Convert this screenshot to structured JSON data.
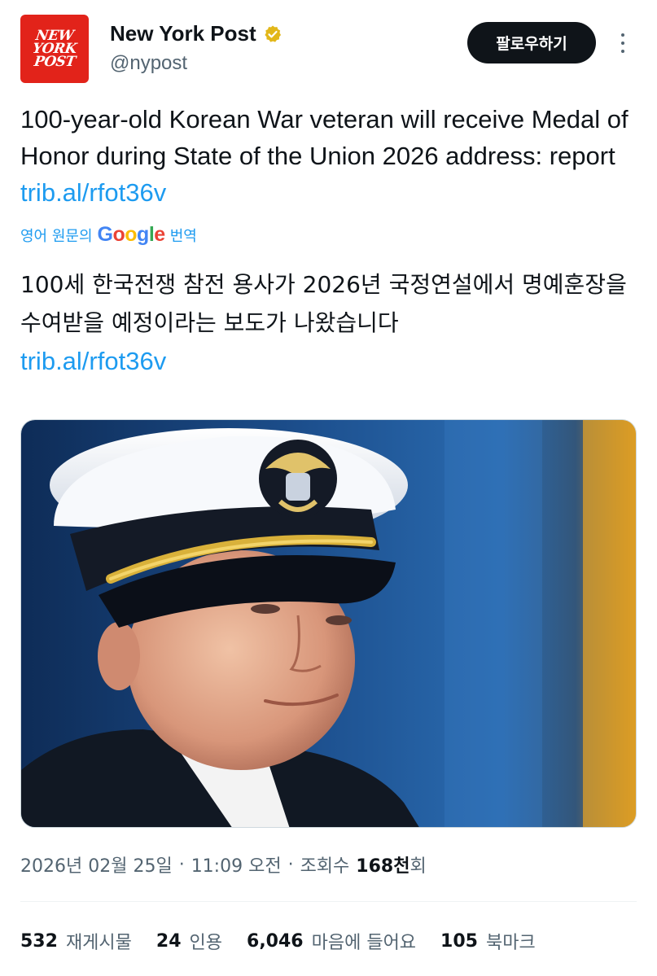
{
  "account": {
    "logo_lines": [
      "NEW",
      "YORK",
      "POST"
    ],
    "display_name": "New York Post",
    "handle": "@nypost",
    "verified_badge": "gold-check-icon",
    "follow_label": "팔로우하기"
  },
  "tweet": {
    "text": "100-year-old Korean War veteran will receive Medal of Honor during State of the Union 2026 address: report",
    "link": "trib.al/rfot36v"
  },
  "translation": {
    "prefix": "영어 원문의",
    "provider_letters": [
      "G",
      "o",
      "o",
      "g",
      "l",
      "e"
    ],
    "suffix": "번역",
    "text": "100세 한국전쟁 참전 용사가 2026년 국정연설에서 명예훈장을 수여받을 예정이라는 보도가 나왔습니다",
    "link": "trib.al/rfot36v"
  },
  "media": {
    "description_icon": "photo-veteran-naval-cap"
  },
  "meta": {
    "date": "2026년 02월 25일",
    "time": "11:09 오전",
    "views_label": "조회수",
    "views_value": "168천",
    "views_unit": "회"
  },
  "stats": [
    {
      "value": "532",
      "label": "재게시물"
    },
    {
      "value": "24",
      "label": "인용"
    },
    {
      "value": "6,046",
      "label": "마음에 들어요"
    },
    {
      "value": "105",
      "label": "북마크"
    }
  ],
  "colors": {
    "link": "#1d9bf0",
    "secondary_text": "#536471",
    "verified_gold": "#e2b719",
    "brand_red": "#e2231a"
  }
}
